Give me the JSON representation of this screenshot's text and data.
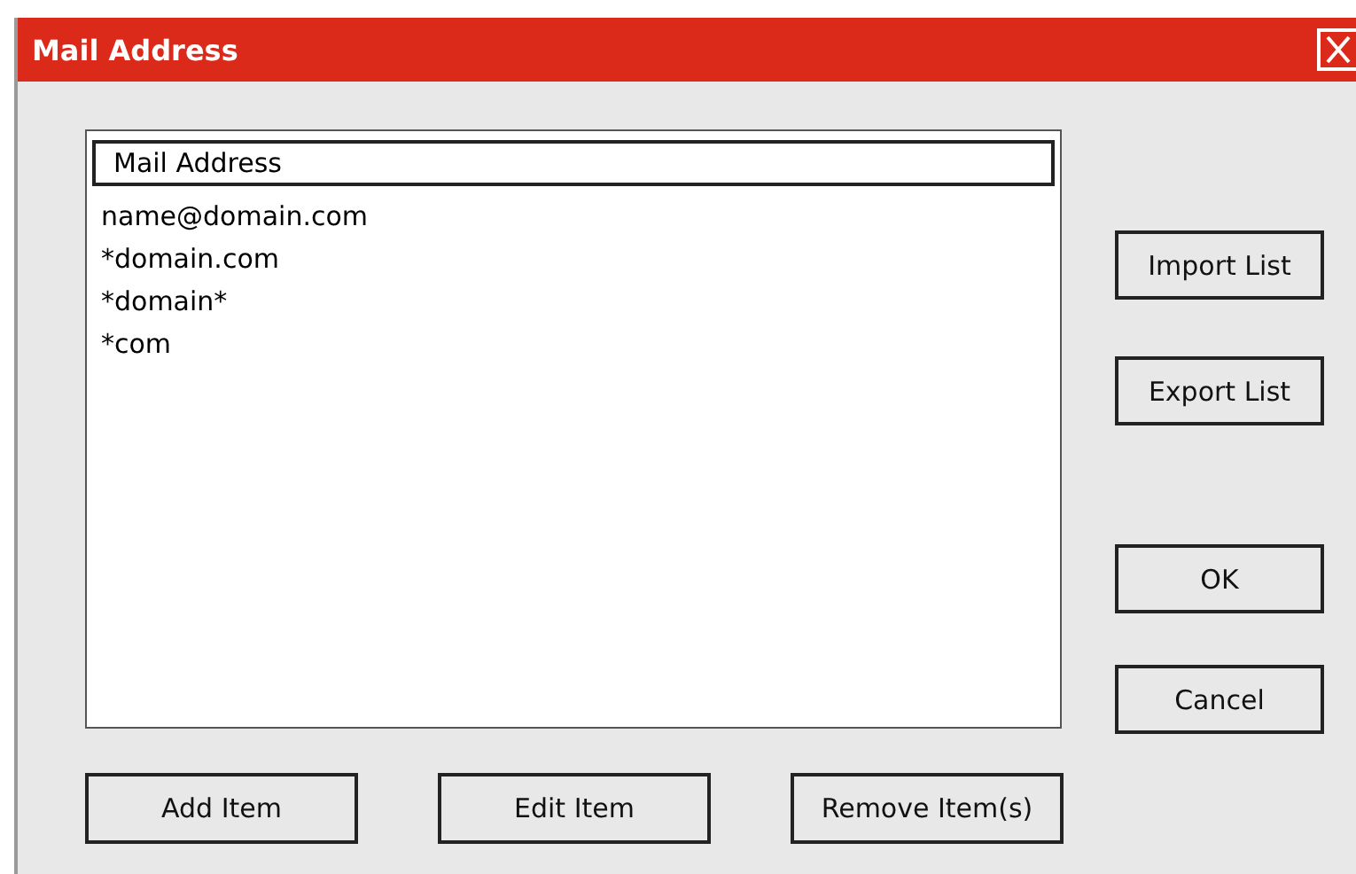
{
  "window": {
    "title": "Mail Address"
  },
  "list": {
    "header": "Mail Address",
    "items": [
      "name@domain.com",
      "*domain.com",
      "*domain*",
      "*com"
    ]
  },
  "side_buttons": [
    "Import List",
    "Export List"
  ],
  "dialog_buttons": [
    "OK",
    "Cancel"
  ],
  "bottom_buttons": [
    "Add Item",
    "Edit Item",
    "Remove Item(s)"
  ]
}
